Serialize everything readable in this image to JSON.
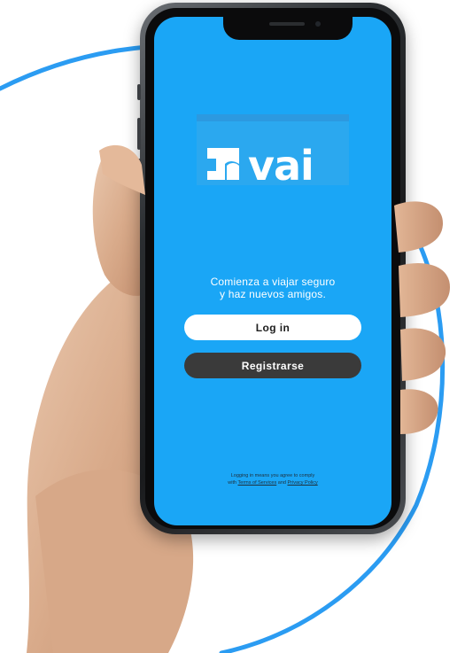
{
  "app": {
    "logo_text": "vai",
    "tagline_line1": "Comienza a viajar seguro",
    "tagline_line2": "y haz nuevos amigos."
  },
  "buttons": {
    "login_label": "Log in",
    "register_label": "Registrarse"
  },
  "legal": {
    "line1": "Logging in means you agree to comply",
    "prefix": "with ",
    "terms_link": "Terms of Services",
    "and": " and ",
    "privacy_link": "Privacy Policy"
  },
  "colors": {
    "screen_bg": "#1aa6f6",
    "accent_circle": "#2b9cf2",
    "login_bg": "#ffffff",
    "register_bg": "#3a3a3a"
  },
  "icons": {
    "logo_mark": "vai-logo-mark"
  }
}
